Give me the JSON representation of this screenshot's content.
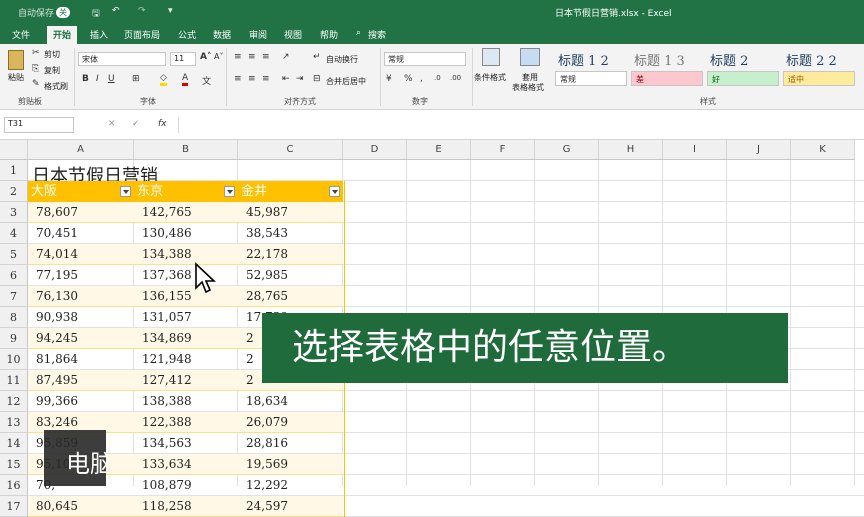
{
  "titlebar": {
    "autosave": "自动保存",
    "toggle": "关",
    "file_title": "日本节假日营销.xlsx  -  Excel"
  },
  "tabs": [
    "文件",
    "开始",
    "插入",
    "页面布局",
    "公式",
    "数据",
    "审阅",
    "视图",
    "帮助"
  ],
  "search": "搜索",
  "ribbon": {
    "clipboard": {
      "paste": "粘贴",
      "cut": "剪切",
      "copy": "复制",
      "format_painter": "格式刷",
      "label": "剪贴板"
    },
    "font": {
      "name": "宋体",
      "size": "11",
      "label": "字体"
    },
    "alignment": {
      "wrap": "自动换行",
      "merge": "合并后居中",
      "label": "对齐方式"
    },
    "number": {
      "format": "常规",
      "label": "数字"
    },
    "styles": {
      "conditional": "条件格式",
      "table": "套用",
      "table2": "表格格式",
      "label": "样式",
      "headings": [
        "标题 1 2",
        "标题 1 3",
        "标题 2",
        "标题 2 2"
      ],
      "cells": [
        "常规",
        "差",
        "好",
        "适中"
      ]
    }
  },
  "formula_bar": {
    "name_box": "T31",
    "fx": "fx",
    "formula": ""
  },
  "columns": [
    "A",
    "B",
    "C",
    "D",
    "E",
    "F",
    "G",
    "H",
    "I",
    "J",
    "K"
  ],
  "rows": [
    "1",
    "2",
    "3",
    "4",
    "5",
    "6",
    "7",
    "8",
    "9",
    "10",
    "11",
    "12",
    "13",
    "14",
    "15",
    "16",
    "17"
  ],
  "sheet": {
    "title": "日本节假日营销",
    "headers": [
      "大阪",
      "东京",
      "金井"
    ],
    "data": [
      [
        "78,607",
        "142,765",
        "45,987"
      ],
      [
        "70,451",
        "130,486",
        "38,543"
      ],
      [
        "74,014",
        "134,388",
        "22,178"
      ],
      [
        "77,195",
        "137,368",
        "52,985"
      ],
      [
        "76,130",
        "136,155",
        "28,765"
      ],
      [
        "90,938",
        "131,057",
        "17,739"
      ],
      [
        "94,245",
        "134,869",
        "2"
      ],
      [
        "81,864",
        "121,948",
        "2"
      ],
      [
        "87,495",
        "127,412",
        "2"
      ],
      [
        "99,366",
        "138,388",
        "18,634"
      ],
      [
        "83,246",
        "122,388",
        "26,079"
      ],
      [
        "95,859",
        "134,563",
        "28,816"
      ],
      [
        "95,105",
        "133,634",
        "19,569"
      ],
      [
        "70,",
        "108,879",
        "12,292"
      ],
      [
        "80,645",
        "118,258",
        "24,597"
      ]
    ]
  },
  "caption": "选择表格中的任意位置。",
  "watermark": "电脑",
  "colors": {
    "excel_green": "#217346",
    "table_header": "#ffc000",
    "caption_bg": "#1f6b3c"
  }
}
